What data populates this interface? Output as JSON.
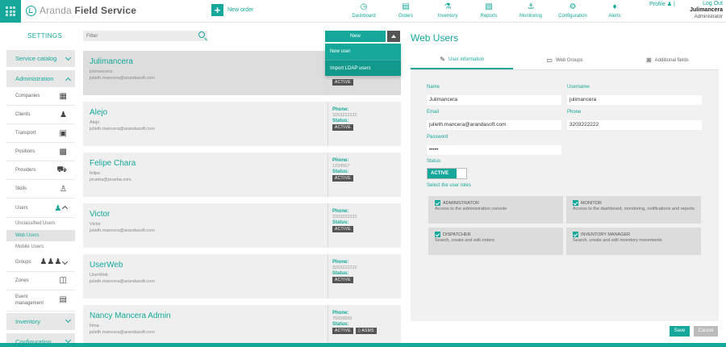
{
  "header": {
    "brand_light": "Aranda",
    "brand_bold": "Field Service",
    "new_order_label": "New order",
    "nav": [
      {
        "label": "Dashboard",
        "icon": "dashboard-icon"
      },
      {
        "label": "Orders",
        "icon": "orders-icon"
      },
      {
        "label": "Inventory",
        "icon": "inventory-icon"
      },
      {
        "label": "Reports",
        "icon": "reports-icon"
      },
      {
        "label": "Monitoring",
        "icon": "monitoring-icon"
      },
      {
        "label": "Configuration",
        "icon": "gear-icon"
      },
      {
        "label": "Alerts",
        "icon": "bell-icon"
      }
    ],
    "profile_label": "Profile",
    "profile_separator": "|",
    "logout_label": "Log Out",
    "username": "Julimancera",
    "role": "Administrator"
  },
  "sidebar": {
    "title": "SETTINGS",
    "service_catalog": "Service catalog",
    "administration": "Administration",
    "admin_items": [
      {
        "label": "Companies",
        "icon": "building-icon"
      },
      {
        "label": "Clients",
        "icon": "person-icon"
      },
      {
        "label": "Transport",
        "icon": "bus-icon"
      },
      {
        "label": "Positions",
        "icon": "briefcase-icon"
      },
      {
        "label": "Providers",
        "icon": "truck-icon"
      },
      {
        "label": "Skills",
        "icon": "walking-person-icon"
      }
    ],
    "users": "Users",
    "user_subs": [
      "Unclassified Users",
      "Web Users",
      "Mobile Users"
    ],
    "groups": "Groups",
    "zones": "Zones",
    "event_line1": "Event",
    "event_line2": "management",
    "inventory": "Inventory",
    "configuration": "Configuration"
  },
  "list": {
    "filter_placeholder": "Filter",
    "new_button": "New",
    "dropdown_items": [
      "New user",
      "Import LDAP users"
    ],
    "phone_label": "Phone:",
    "status_label": "Status:",
    "cards": [
      {
        "name": "Julimancera",
        "user": "julimancera",
        "email": "julieth.mancera@arandasoft.com",
        "phone": "",
        "status": "ACTIVE"
      },
      {
        "name": "Alejo",
        "user": "Alejo",
        "email": "julieth.mancera@arandasoft.com",
        "phone": "3203222222",
        "status": "ACTIVE"
      },
      {
        "name": "Felipe Chara",
        "user": "felipe",
        "email": "prueba@prueba.com",
        "phone": "1234567",
        "status": "ACTIVE"
      },
      {
        "name": "Victor",
        "user": "Victor",
        "email": "julieth.mancera@arandasoft.com",
        "phone": "3203222222",
        "status": "ACTIVE"
      },
      {
        "name": "UserWeb",
        "user": "UserWeb",
        "email": "julieth.mancera@arandasoft.com",
        "phone": "3203222222",
        "status": "ACTIVE"
      },
      {
        "name": "Nancy Mancera Admin",
        "user": "Nma",
        "email": "julieth.mancera@arandasoft.com",
        "phone": "75656565",
        "status": "ACTIVE",
        "extra_badge": "ASMS"
      }
    ]
  },
  "form": {
    "title": "Web Users",
    "tabs": [
      "User information",
      "Web Groups",
      "Additional fields"
    ],
    "name_label": "Name",
    "name_value": "Julimancera",
    "username_label": "Username",
    "username_value": "julimancera",
    "email_label": "Email",
    "email_value": "julieth.mancera@arandasoft.com",
    "phone_label": "Phone",
    "phone_value": "3203222222",
    "password_label": "Password",
    "password_value": "•••••",
    "status_label": "Status",
    "status_value": "ACTIVE",
    "roles_label": "Select the user roles",
    "roles": [
      {
        "title": "ADMINISTRATOR",
        "desc": "Access to the administration console"
      },
      {
        "title": "MONITOR",
        "desc": "Access to the dashboard, monitoring, notifications and reports"
      },
      {
        "title": "DISPATCHER",
        "desc": "Search, create and edit orders"
      },
      {
        "title": "INVENTORY MANAGER",
        "desc": "Search, create and edit inventory movements"
      }
    ],
    "save": "Save",
    "cancel": "Cancel"
  },
  "colors": {
    "accent": "#15a89a",
    "dark": "#555555",
    "panel": "#f1f1f1"
  }
}
